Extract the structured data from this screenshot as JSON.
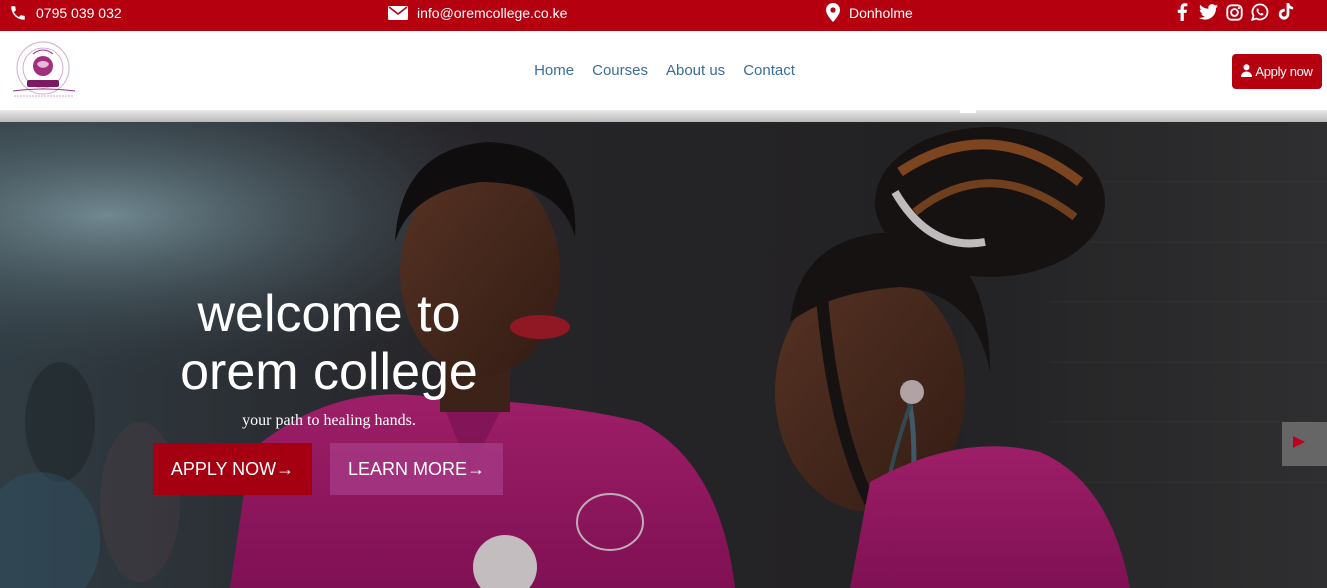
{
  "topbar": {
    "phone": "0795 039 032",
    "email": "info@oremcollege.co.ke",
    "location": "Donholme",
    "social": [
      "facebook-icon",
      "twitter-icon",
      "instagram-icon",
      "whatsapp-icon",
      "tiktok-icon"
    ]
  },
  "header": {
    "logo_text": "OREM COLLEGE",
    "nav": [
      "Home",
      "Courses",
      "About us",
      "Contact"
    ],
    "apply_label": "Apply now"
  },
  "hero": {
    "title_line1": "welcome to",
    "title_line2": "orem college",
    "subtitle": "your path to healing hands.",
    "apply_button": "APPLY NOW→",
    "learn_button": "LEARN MORE→"
  },
  "colors": {
    "brand_red": "#b5000f",
    "nav_link": "#3a6d9a",
    "scrub_magenta": "#c0267f"
  }
}
